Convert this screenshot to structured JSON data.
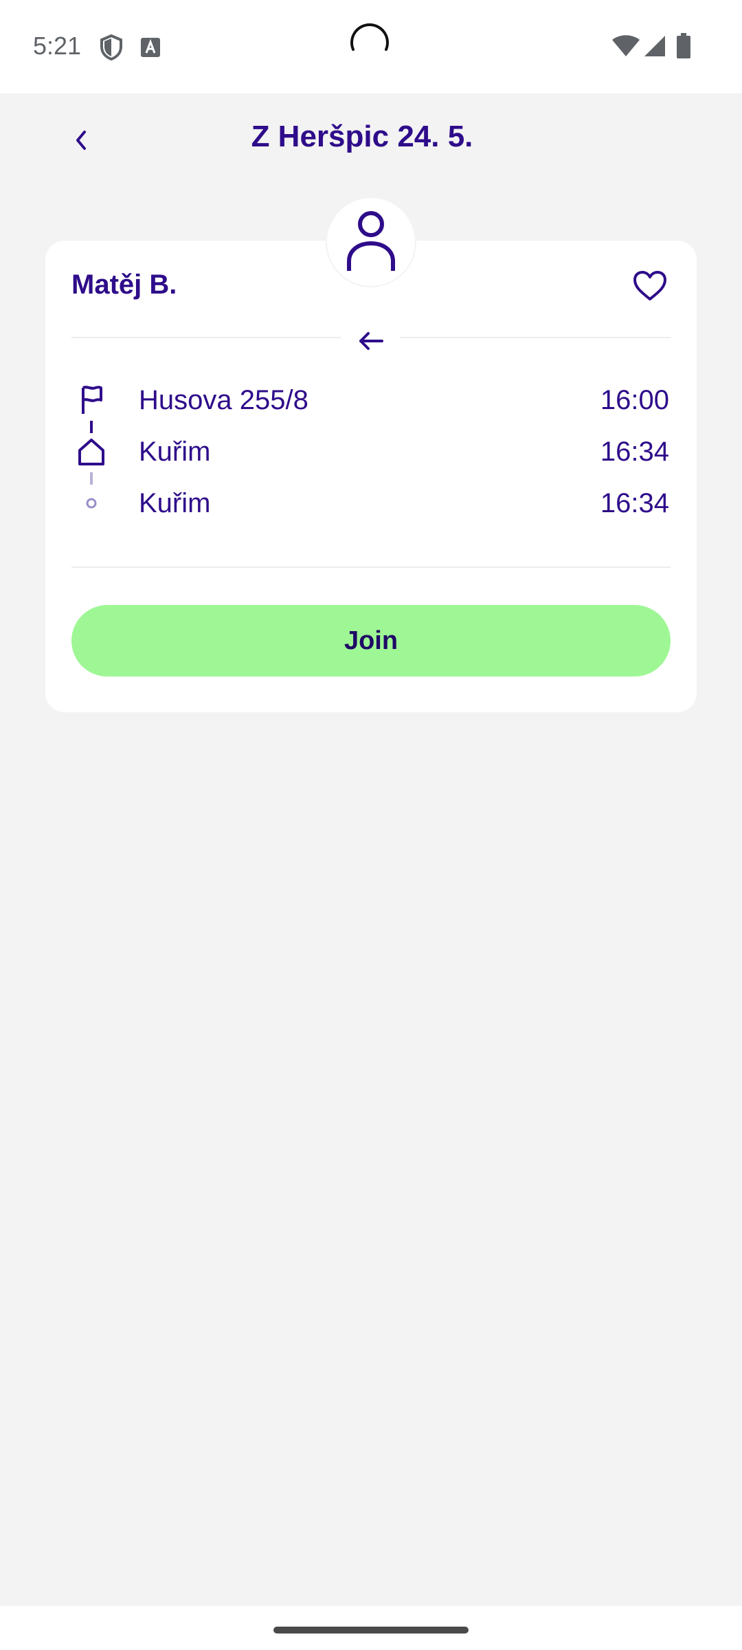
{
  "status_bar": {
    "time": "5:21",
    "icons": [
      "shield-icon",
      "keyboard-a-icon",
      "wifi-icon",
      "signal-icon",
      "battery-icon"
    ]
  },
  "header": {
    "title": "Z Heršpic 24. 5.",
    "back_icon": "chevron-left-icon"
  },
  "ride": {
    "driver_name": "Matěj B.",
    "avatar_icon": "person-icon",
    "favorite_icon": "heart-outline-icon",
    "direction_icon": "arrow-left-icon",
    "stops": [
      {
        "icon": "flag-icon",
        "name": "Husova 255/8",
        "time": "16:00"
      },
      {
        "icon": "home-icon",
        "name": "Kuřim",
        "time": "16:34"
      },
      {
        "icon": "dot-icon",
        "name": "Kuřim",
        "time": "16:34"
      }
    ],
    "join_label": "Join"
  },
  "colors": {
    "primary": "#2e0c8a",
    "join_button": "#9ef794",
    "background": "#f3f3f3",
    "card": "#ffffff"
  }
}
